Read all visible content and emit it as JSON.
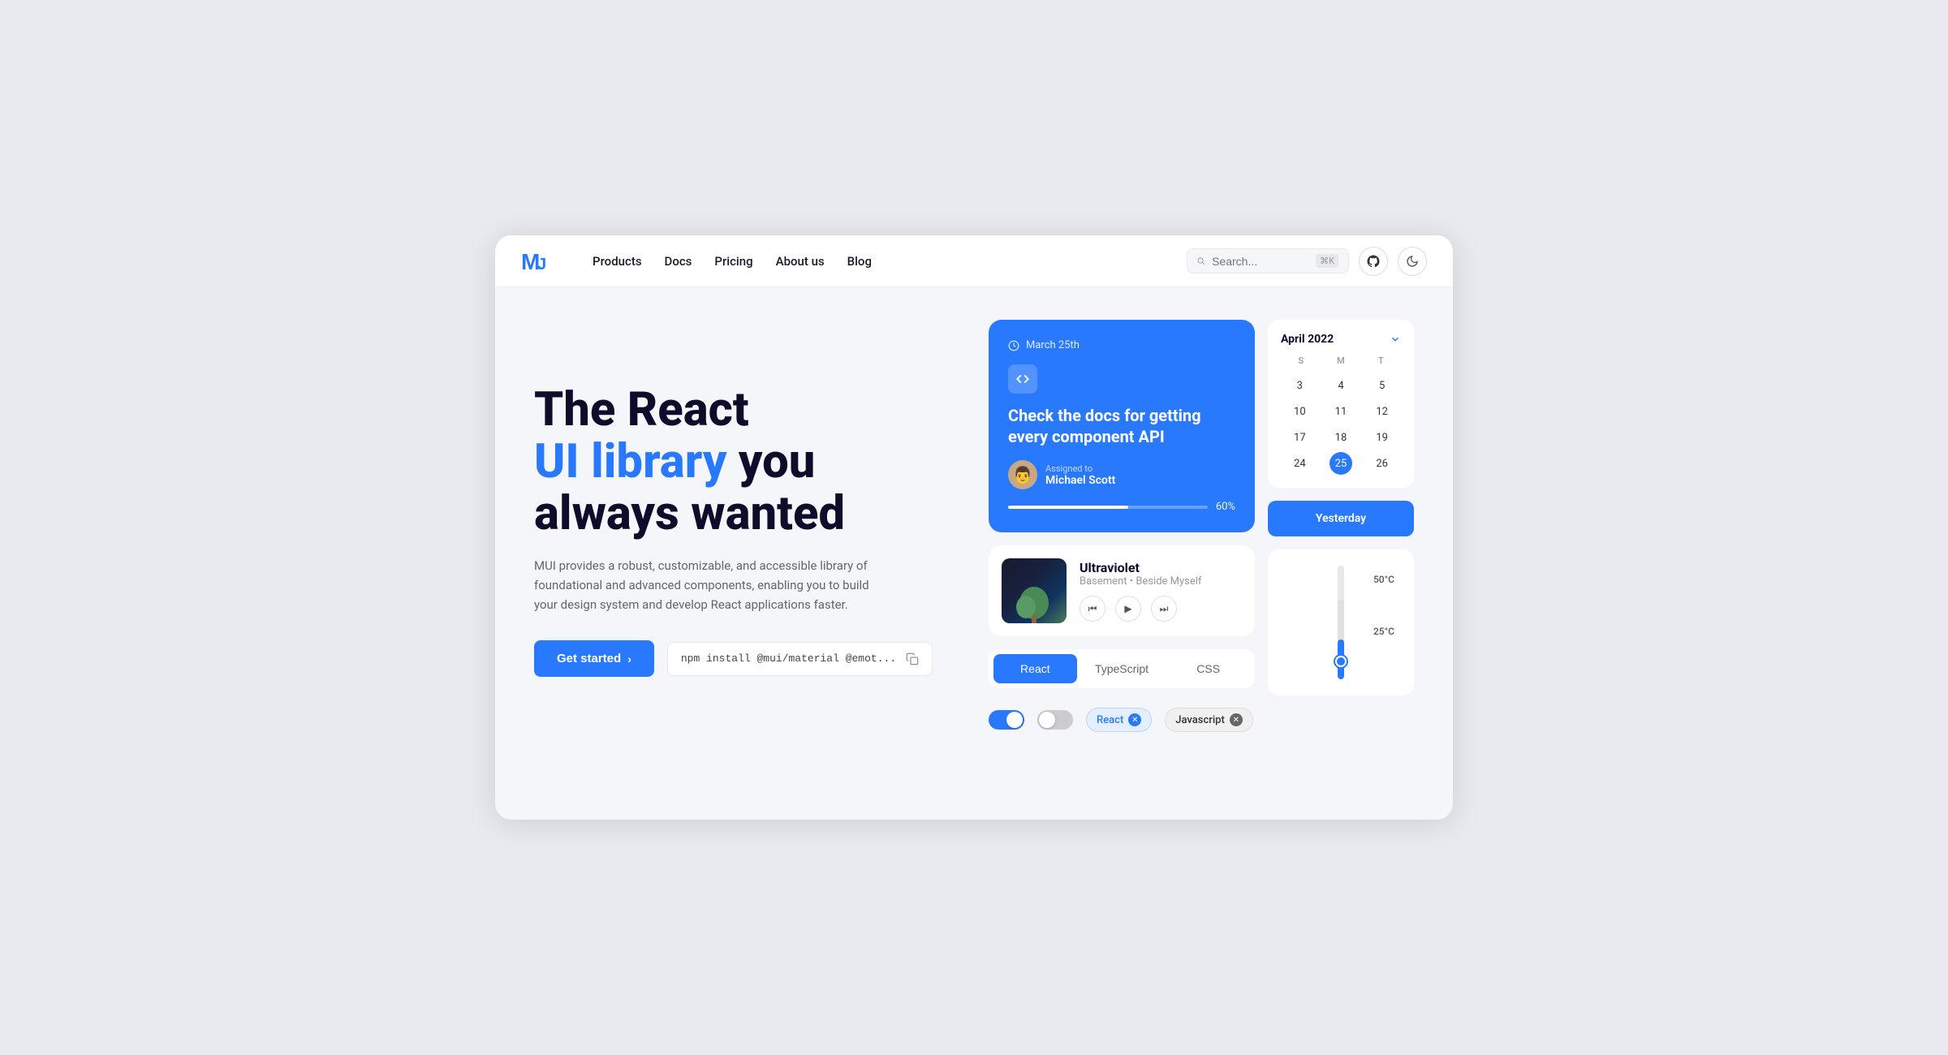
{
  "window": {
    "background": "#f5f6fa"
  },
  "navbar": {
    "logo_text": "MU",
    "links": [
      {
        "label": "Products",
        "id": "products"
      },
      {
        "label": "Docs",
        "id": "docs"
      },
      {
        "label": "Pricing",
        "id": "pricing"
      },
      {
        "label": "About us",
        "id": "about"
      },
      {
        "label": "Blog",
        "id": "blog"
      }
    ],
    "search_placeholder": "Search...",
    "search_shortcut": "⌘K"
  },
  "hero": {
    "title_line1": "The React",
    "title_line2": "UI library",
    "title_line3": "you",
    "title_line4": "always wanted",
    "description": "MUI provides a robust, customizable, and accessible library of foundational and advanced components, enabling you to build your design system and develop React applications faster.",
    "cta_label": "Get started",
    "code_snippet": "npm install @mui/material @emot..."
  },
  "task_card": {
    "date": "March 25th",
    "title": "Check the docs for getting every component API",
    "assignee_label": "Assigned to",
    "assignee_name": "Michael Scott",
    "progress": 60,
    "progress_label": "60%"
  },
  "music_card": {
    "title": "Ultraviolet",
    "artist": "Basement • Beside Myself"
  },
  "tabs": {
    "items": [
      {
        "label": "React",
        "active": true
      },
      {
        "label": "TypeScript",
        "active": false
      },
      {
        "label": "CSS",
        "active": false
      }
    ]
  },
  "chips": [
    {
      "label": "React",
      "active": true
    },
    {
      "label": "Javascript",
      "active": false
    }
  ],
  "calendar": {
    "month": "April 2022",
    "day_headers": [
      "S",
      "M",
      "T"
    ],
    "rows": [
      [
        3,
        4,
        5
      ],
      [
        10,
        11,
        12
      ],
      [
        17,
        18,
        19
      ],
      [
        24,
        25,
        26
      ]
    ],
    "active_day": 25
  },
  "yesterday_btn": "Yesterday",
  "thermometer": {
    "label_50": "50°C",
    "label_25": "25°C"
  }
}
